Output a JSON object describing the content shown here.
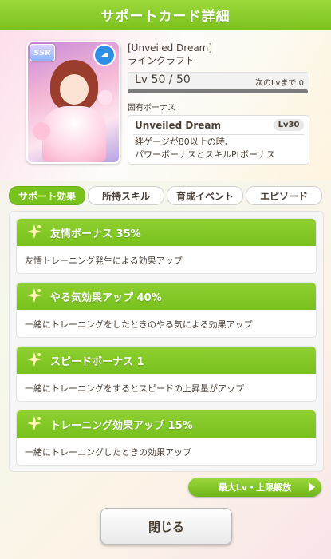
{
  "header": {
    "title": "サポートカード詳細"
  },
  "card": {
    "rarity": "SSR",
    "type_icon": "speed-type-icon",
    "title": "[Unveiled Dream]",
    "name": "ラインクラフト",
    "level_text": "Lv 50 / 50",
    "next_level_label": "次のLvまで 0",
    "level_progress": 1.0
  },
  "unique_bonus": {
    "label": "固有ボーナス",
    "name": "Unveiled Dream",
    "level_badge": "Lv30",
    "desc_line1": "絆ゲージが80以上の時、",
    "desc_line2": "パワーボーナスとスキルPtボーナス"
  },
  "tabs": [
    {
      "label": "サポート効果",
      "active": true
    },
    {
      "label": "所持スキル",
      "active": false
    },
    {
      "label": "育成イベント",
      "active": false
    },
    {
      "label": "エピソード",
      "active": false
    }
  ],
  "effects": [
    {
      "title": "友情ボーナス 35%",
      "desc": "友情トレーニング発生による効果アップ"
    },
    {
      "title": "やる気効果アップ 40%",
      "desc": "一緒にトレーニングをしたときのやる気による効果アップ"
    },
    {
      "title": "スピードボーナス 1",
      "desc": "一緒にトレーニングをするとスピードの上昇量がアップ"
    },
    {
      "title": "トレーニング効果アップ 15%",
      "desc": "一緒にトレーニングしたときの効果アップ"
    }
  ],
  "buttons": {
    "max_level": "最大Lv・上限解放",
    "close": "閉じる"
  },
  "colors": {
    "accent_green": "#79c21d"
  }
}
